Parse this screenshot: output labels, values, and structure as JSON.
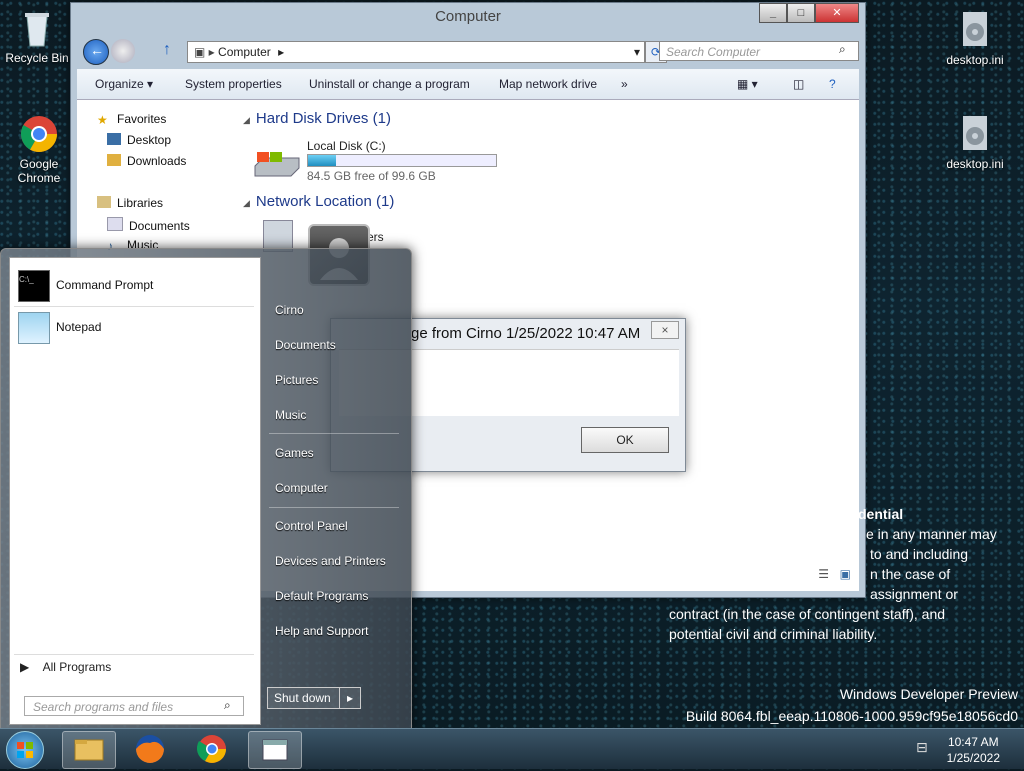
{
  "desktop": {
    "icons": [
      {
        "label": "Recycle Bin"
      },
      {
        "label": "Google Chrome"
      },
      {
        "label": "desktop.ini"
      },
      {
        "label": "desktop.ini"
      }
    ],
    "watermark": {
      "line1": "Windows Developer Preview",
      "line2": "Build 8064.fbl_eeap.110806-1000.959cf95e18056cd0"
    },
    "confidential": {
      "heading": "dential",
      "lines": [
        "e in any manner may",
        "to and including",
        "n the case of",
        "assignment or",
        "contract (in the case of contingent staff), and",
        "potential civil and criminal liability."
      ]
    }
  },
  "explorer": {
    "title": "Computer",
    "address": "Computer",
    "search_placeholder": "Search Computer",
    "toolbar": [
      "Organize",
      "System properties",
      "Uninstall or change a program",
      "Map network drive",
      "»"
    ],
    "nav": {
      "favorites": "Favorites",
      "desktop": "Desktop",
      "downloads": "Downloads",
      "libraries": "Libraries",
      "documents": "Documents",
      "music": "Music"
    },
    "hard_disk_header": "Hard Disk Drives (1)",
    "disk": {
      "name": "Local Disk (C:)",
      "free": "84.5 GB free of 99.6 GB",
      "used_fraction": 0.15
    },
    "network_header": "Network Location (1)",
    "network_item": "ers"
  },
  "dialog": {
    "title": "ge from Cirno 1/25/2022 10:47 AM",
    "ok": "OK",
    "close": "×"
  },
  "start_menu": {
    "programs": [
      "Command Prompt",
      "Notepad"
    ],
    "all_programs": "All Programs",
    "search_placeholder": "Search programs and files",
    "right": {
      "user": "Cirno",
      "documents": "Documents",
      "pictures": "Pictures",
      "music": "Music",
      "games": "Games",
      "computer": "Computer",
      "control_panel": "Control Panel",
      "devices": "Devices and Printers",
      "default_programs": "Default Programs",
      "help": "Help and Support"
    },
    "shutdown": "Shut down"
  },
  "taskbar": {
    "time": "10:47 AM",
    "date": "1/25/2022"
  },
  "colors": {
    "accent": "#1e3a8a",
    "disk_fill": "#2ea8d8"
  }
}
